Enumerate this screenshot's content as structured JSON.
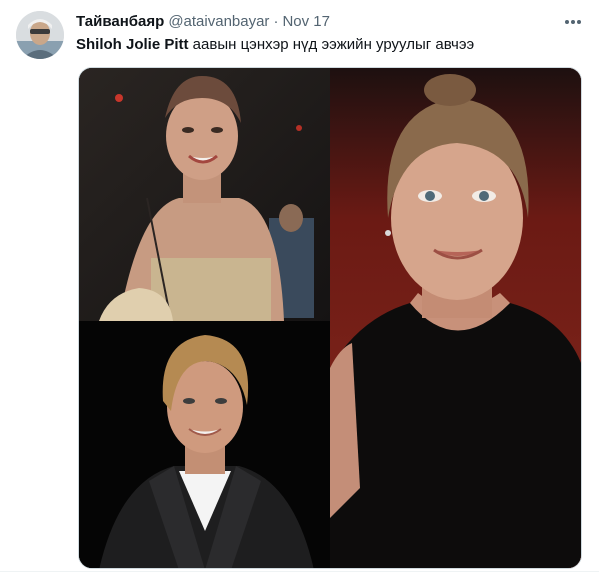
{
  "tweet": {
    "author": {
      "display_name": "Тайванбаяр",
      "handle": "@ataivanbayar",
      "avatar_icon": "user-avatar"
    },
    "separator": "·",
    "timestamp": "Nov 17",
    "more_icon": "more-icon",
    "text": {
      "bold": "Shiloh Jolie Pitt",
      "rest": " аавын цэнхэр нүд ээжийн уруулыг авчээ"
    },
    "media": {
      "count": 3,
      "layout": "left column two stacked photos, right column one tall photo"
    }
  },
  "colors": {
    "text_primary": "#0f1419",
    "text_secondary": "#536471",
    "border": "#cfd9de"
  }
}
